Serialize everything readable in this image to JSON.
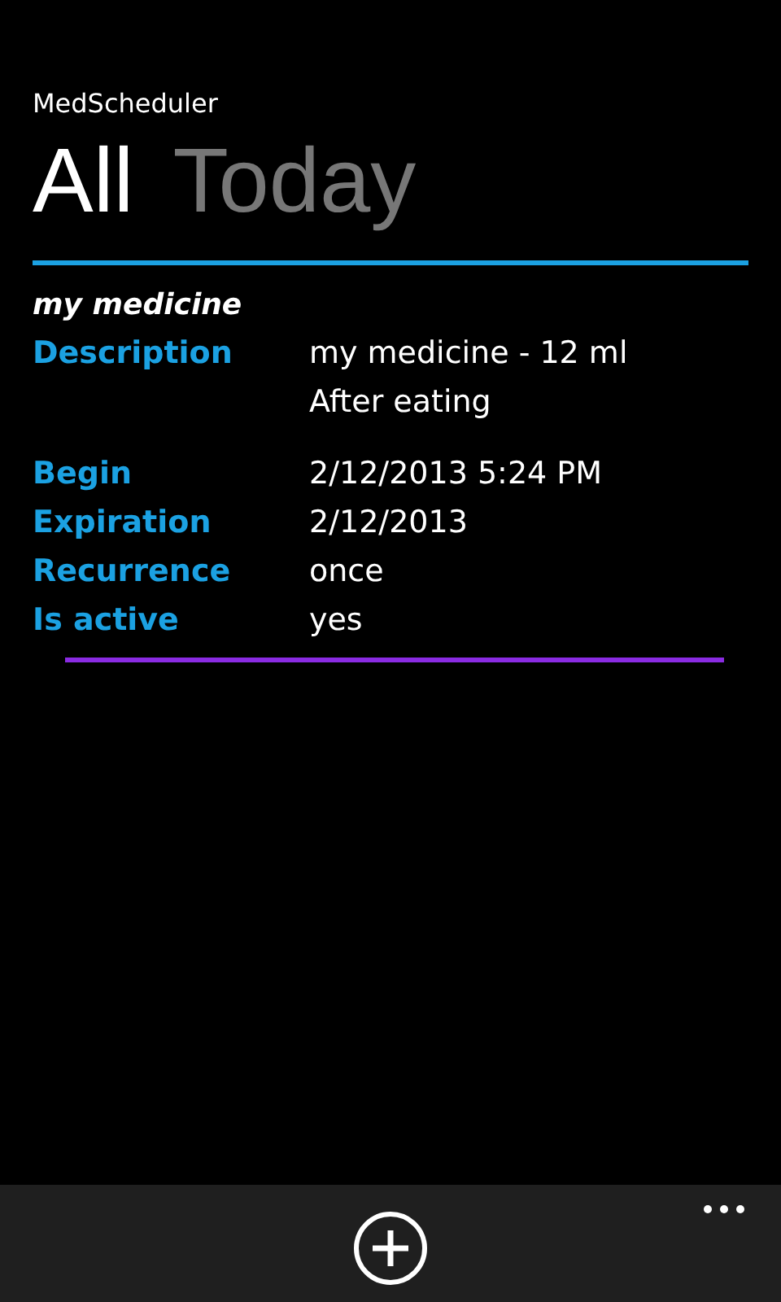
{
  "app_title": "MedScheduler",
  "pivot_items": [
    {
      "label": "All",
      "selected": true
    },
    {
      "label": "Today",
      "selected": false
    }
  ],
  "medicine": {
    "name": "my medicine",
    "fields": [
      {
        "label": "Description",
        "values": [
          "my medicine - 12 ml",
          "After eating"
        ]
      },
      {
        "label": "Begin",
        "values": [
          "2/12/2013 5:24 PM"
        ]
      },
      {
        "label": "Expiration",
        "values": [
          "2/12/2013"
        ]
      },
      {
        "label": "Recurrence",
        "values": [
          "once"
        ]
      },
      {
        "label": "Is active",
        "values": [
          "yes"
        ]
      }
    ]
  },
  "app_bar": {
    "buttons": [
      {
        "kind": "add"
      }
    ],
    "has_menu": true
  }
}
